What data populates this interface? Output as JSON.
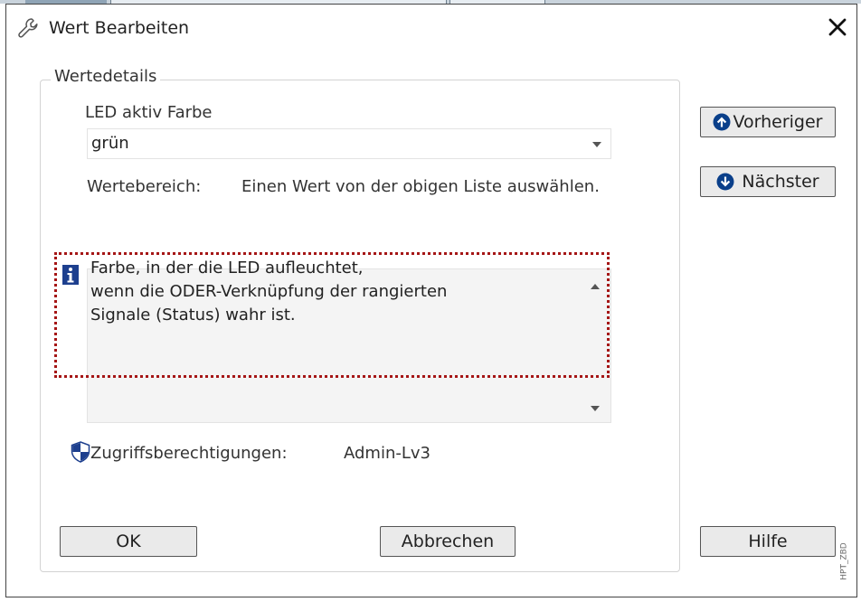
{
  "window": {
    "title": "Wert Bearbeiten",
    "title_icon": "wrench-icon",
    "close_icon": "close-icon"
  },
  "group": {
    "legend": "Wertedetails",
    "field_label": "LED aktiv Farbe",
    "select_value": "grün",
    "range_label": "Wertebereich:",
    "range_value": "Einen Wert von der obigen Liste auswählen.",
    "description": "Farbe, in der die LED aufleuchtet,\nwenn die ODER-Verknüpfung der rangierten\nSignale (Status) wahr ist.",
    "access_label": "Zugriffsberechtigungen:",
    "access_value": "Admin-Lv3"
  },
  "buttons": {
    "previous": "Vorheriger",
    "next": "Nächster",
    "ok": "OK",
    "cancel": "Abbrechen",
    "help": "Hilfe"
  },
  "watermark": "HPT_ZBD",
  "colors": {
    "highlight": "#a51616",
    "nav_icon": "#0a3f8a",
    "info_icon": "#1d3f8e"
  }
}
